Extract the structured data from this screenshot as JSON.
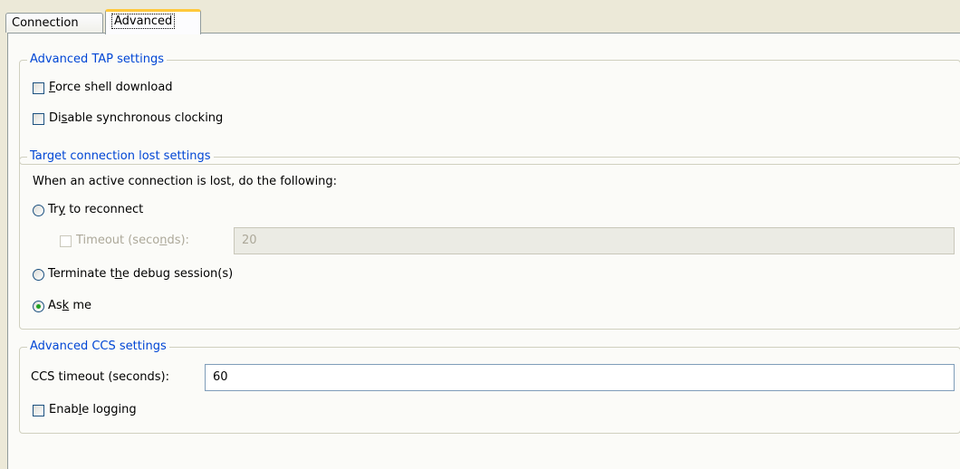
{
  "tabs": {
    "connection": "Connection",
    "advanced": "Advanced"
  },
  "tap_group": {
    "legend": "Advanced TAP settings",
    "force_shell_pre": "",
    "force_shell_ul": "F",
    "force_shell_post": "orce shell download",
    "disable_sync_pre": "Di",
    "disable_sync_ul": "s",
    "disable_sync_post": "able synchronous clocking"
  },
  "lost_group": {
    "legend": "Target connection lost settings",
    "description": "When an active connection is lost, do the following:",
    "reconnect_pre": "Tr",
    "reconnect_ul": "y",
    "reconnect_post": " to reconnect",
    "timeout_pre": "Timeout (seco",
    "timeout_ul": "n",
    "timeout_post": "ds):",
    "timeout_value": "20",
    "terminate_pre": "Terminate t",
    "terminate_ul": "h",
    "terminate_post": "e debug session(s)",
    "askme_pre": "As",
    "askme_ul": "k",
    "askme_post": " me",
    "selected_option": "Ask me"
  },
  "ccs_group": {
    "legend": "Advanced CCS settings",
    "timeout_label": "CCS timeout (seconds):",
    "timeout_value": "60",
    "logging_pre": "Enab",
    "logging_ul": "l",
    "logging_post": "e logging"
  },
  "colors": {
    "legend": "#0046d5",
    "active_tab_accent": "#ffc83c",
    "radio_dot": "#21a121"
  }
}
